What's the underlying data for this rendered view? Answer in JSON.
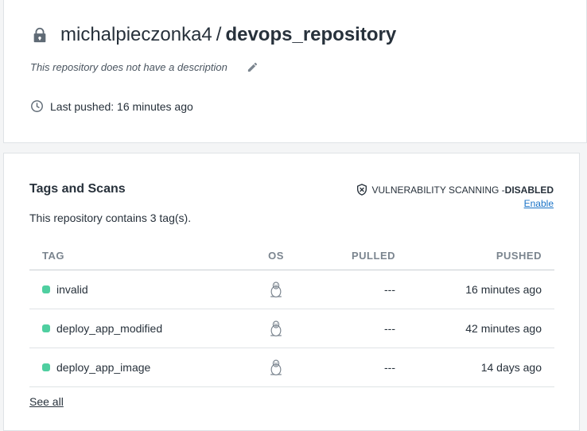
{
  "repo": {
    "owner": "michalpieczonka4",
    "separator": "/",
    "name": "devops_repository",
    "description": "This repository does not have a description",
    "last_pushed": "Last pushed: 16 minutes ago"
  },
  "tags_section": {
    "title": "Tags and Scans",
    "scanning_label": "VULNERABILITY SCANNING - ",
    "scanning_status": "DISABLED",
    "enable_link": "Enable",
    "count_text": "This repository contains 3 tag(s).",
    "columns": {
      "tag": "TAG",
      "os": "OS",
      "pulled": "PULLED",
      "pushed": "PUSHED"
    },
    "rows": [
      {
        "tag": "invalid",
        "os_icon": "linux-icon",
        "pulled": "---",
        "pushed": "16 minutes ago"
      },
      {
        "tag": "deploy_app_modified",
        "os_icon": "linux-icon",
        "pulled": "---",
        "pushed": "42 minutes ago"
      },
      {
        "tag": "deploy_app_image",
        "os_icon": "linux-icon",
        "pulled": "---",
        "pushed": "14 days ago"
      }
    ],
    "see_all": "See all"
  },
  "colors": {
    "status_dot": "#4fcfa0",
    "link": "#1a73c7",
    "text": "#27313b"
  }
}
